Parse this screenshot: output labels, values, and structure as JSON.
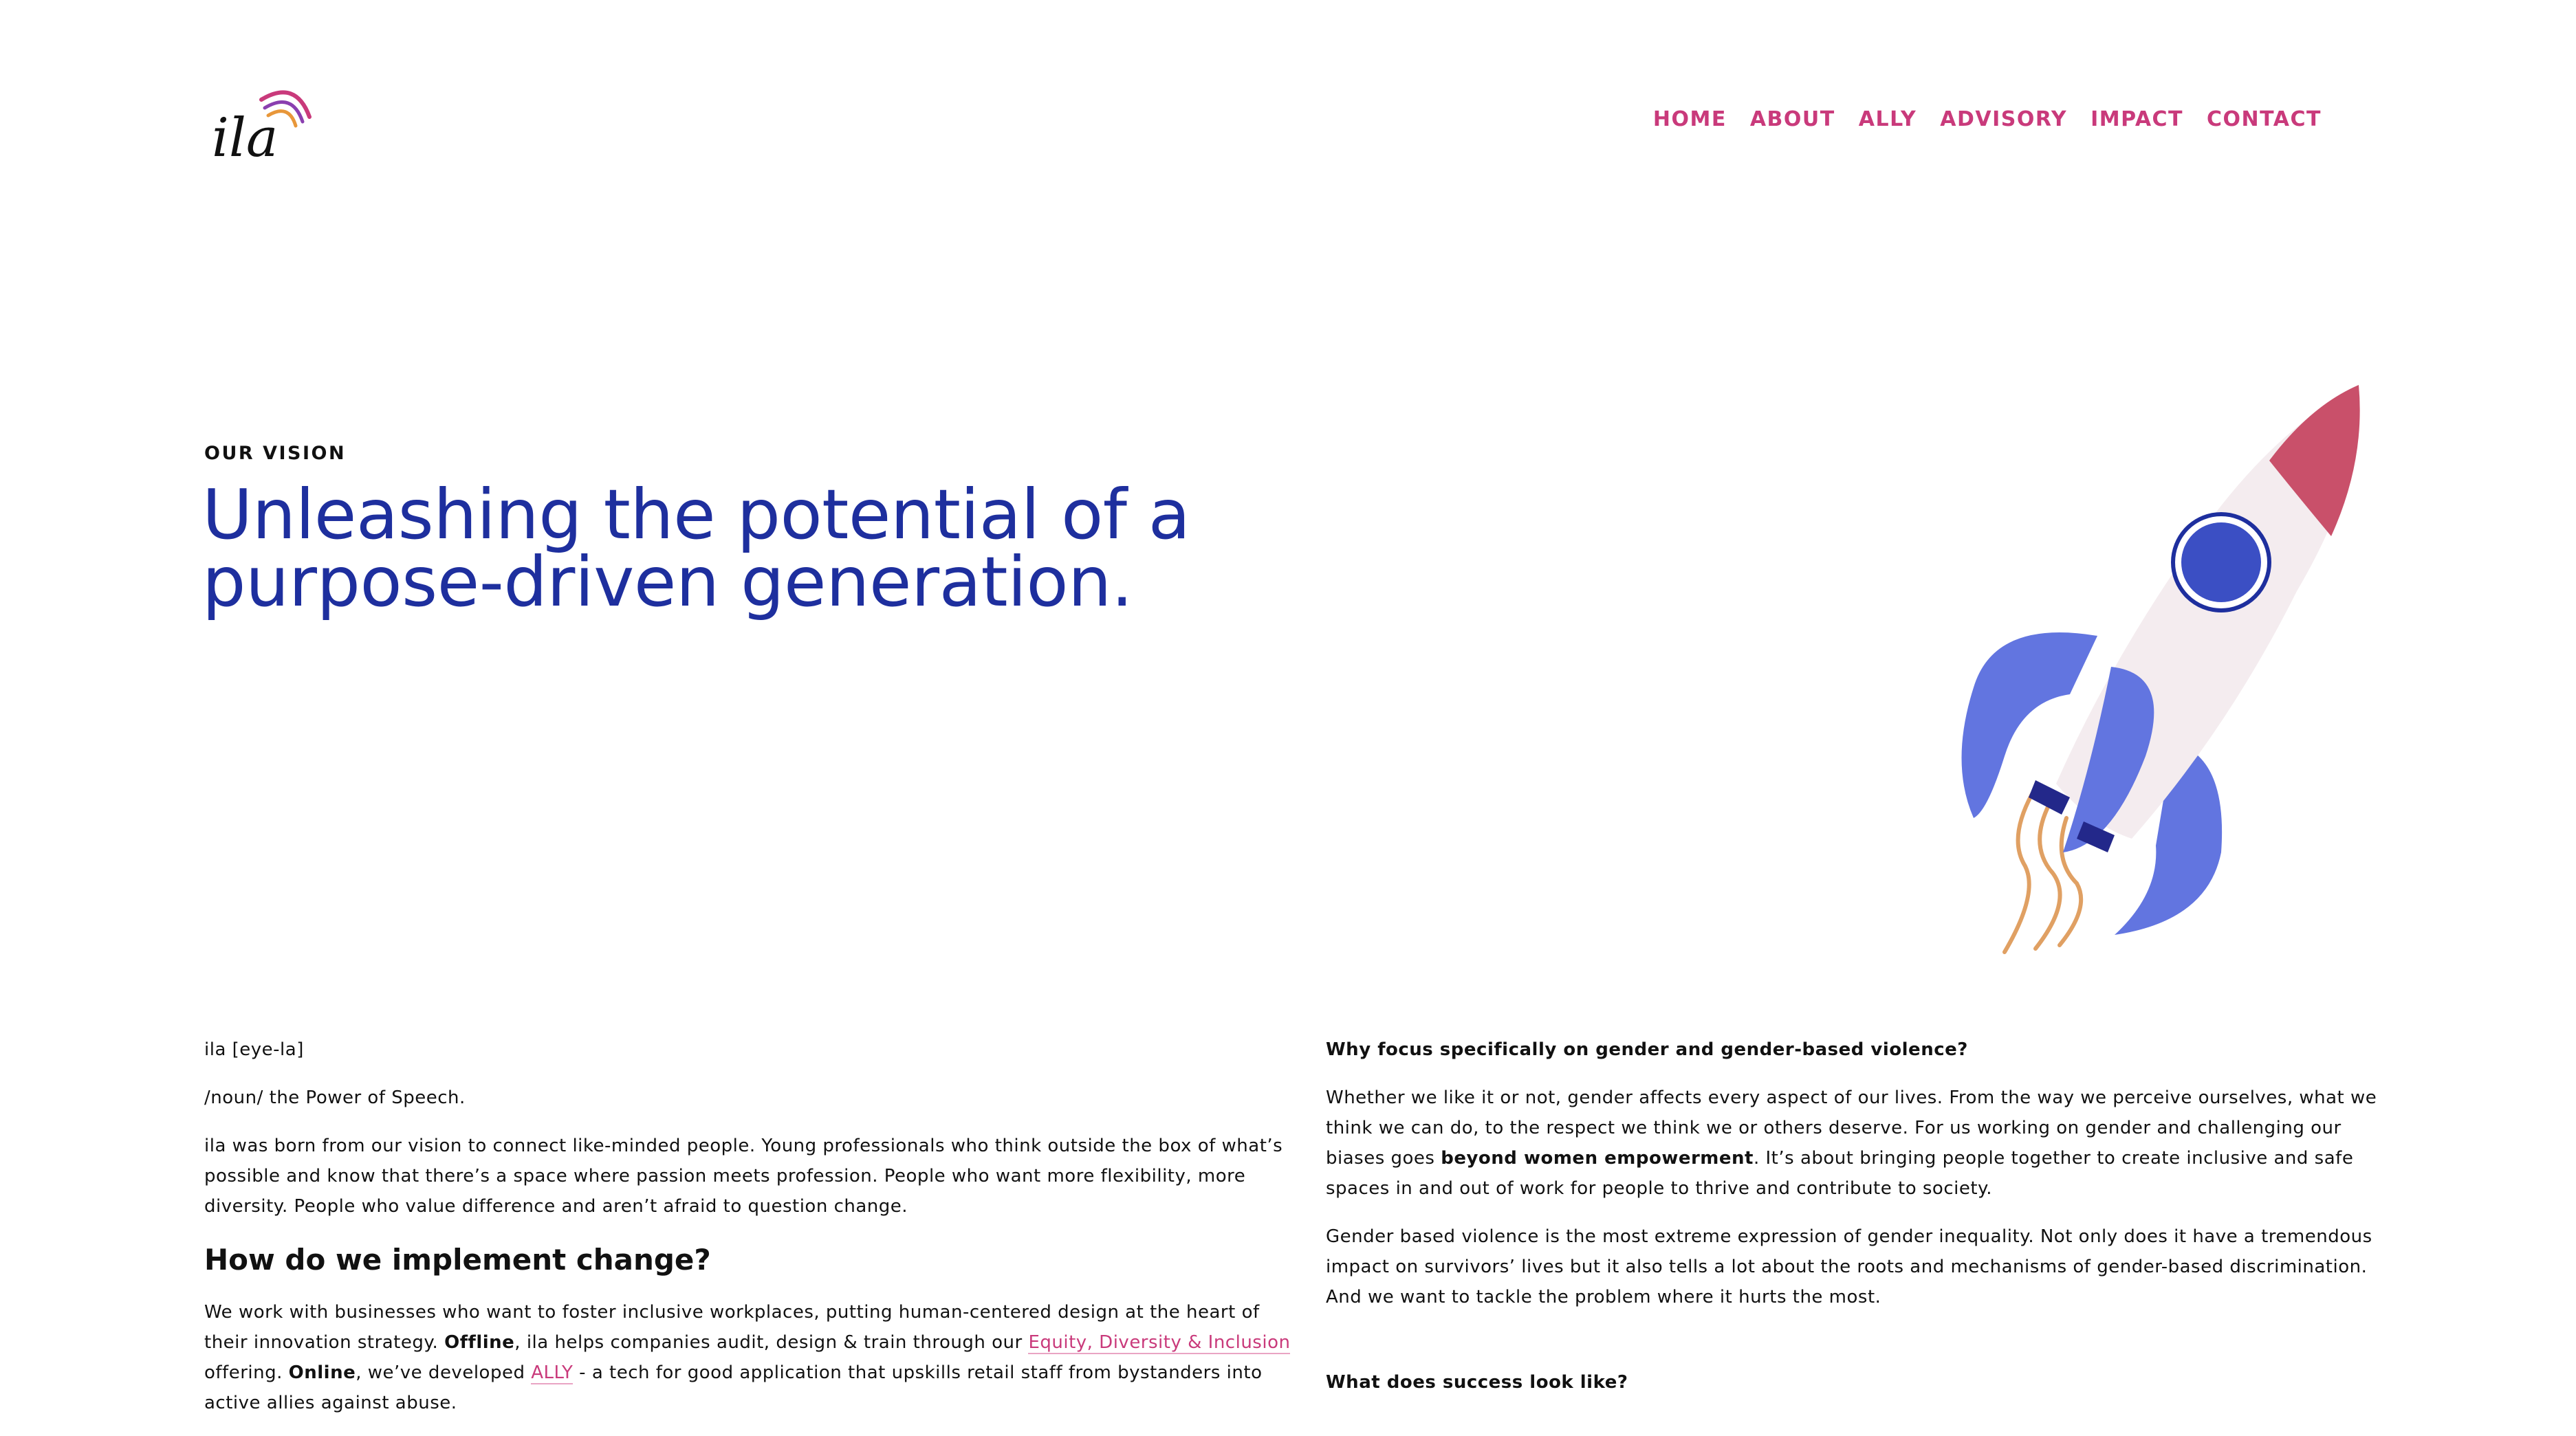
{
  "brand": {
    "logo_text": "ila",
    "colors": {
      "pink": "#c93a7b",
      "blue": "#1e2f9e",
      "orange": "#e8973a"
    }
  },
  "nav": {
    "items": [
      "HOME",
      "ABOUT",
      "ALLY",
      "ADVISORY",
      "IMPACT",
      "CONTACT"
    ]
  },
  "hero": {
    "kicker": "OUR VISION",
    "title_line1": "Unleashing the potential of a",
    "title_line2": "purpose-driven generation."
  },
  "left": {
    "p1": "ila [eye-la]",
    "p2": "/noun/ the Power of Speech.",
    "p3": "ila was born from our vision to connect like-minded people. Young professionals who think outside the box of what’s possible and know that there’s a space where passion meets profession. People who want more flexibility, more diversity. People who value difference and aren’t afraid to question change.",
    "h2": "How do we implement change?",
    "p4_a": "We work with businesses who want to foster inclusive workplaces, putting human-centered design at the heart of their innovation strategy. ",
    "p4_offline": "Offline",
    "p4_b": ", ila helps companies audit, design & train through our ",
    "p4_link1": "Equity, Diversity & Inclusion",
    "p4_c": " offering. ",
    "p4_online": "Online",
    "p4_d": ", we’ve developed ",
    "p4_link2": "ALLY",
    "p4_e": " - a tech for good application that upskills retail staff from bystanders into active allies against abuse."
  },
  "right": {
    "q1": "Why focus specifically on gender and gender-based violence?",
    "p1_a": "Whether we like it or not, gender affects every aspect of our lives. From the way we perceive ourselves, what we think we can do, to the respect we think we or others deserve. For us working on gender and challenging our biases goes ",
    "p1_bold": "beyond women empowerment",
    "p1_b": ". It’s about bringing people together to create inclusive and safe spaces in and out of work for people to thrive and contribute to society.",
    "p2": "Gender based violence is the most extreme expression of gender inequality. Not only does it have a tremendous impact on survivors’ lives but it also tells a lot about the roots and mechanisms of gender-based discrimination. And we want to tackle the problem where it hurts the most.",
    "q2": "What does success look like?"
  }
}
